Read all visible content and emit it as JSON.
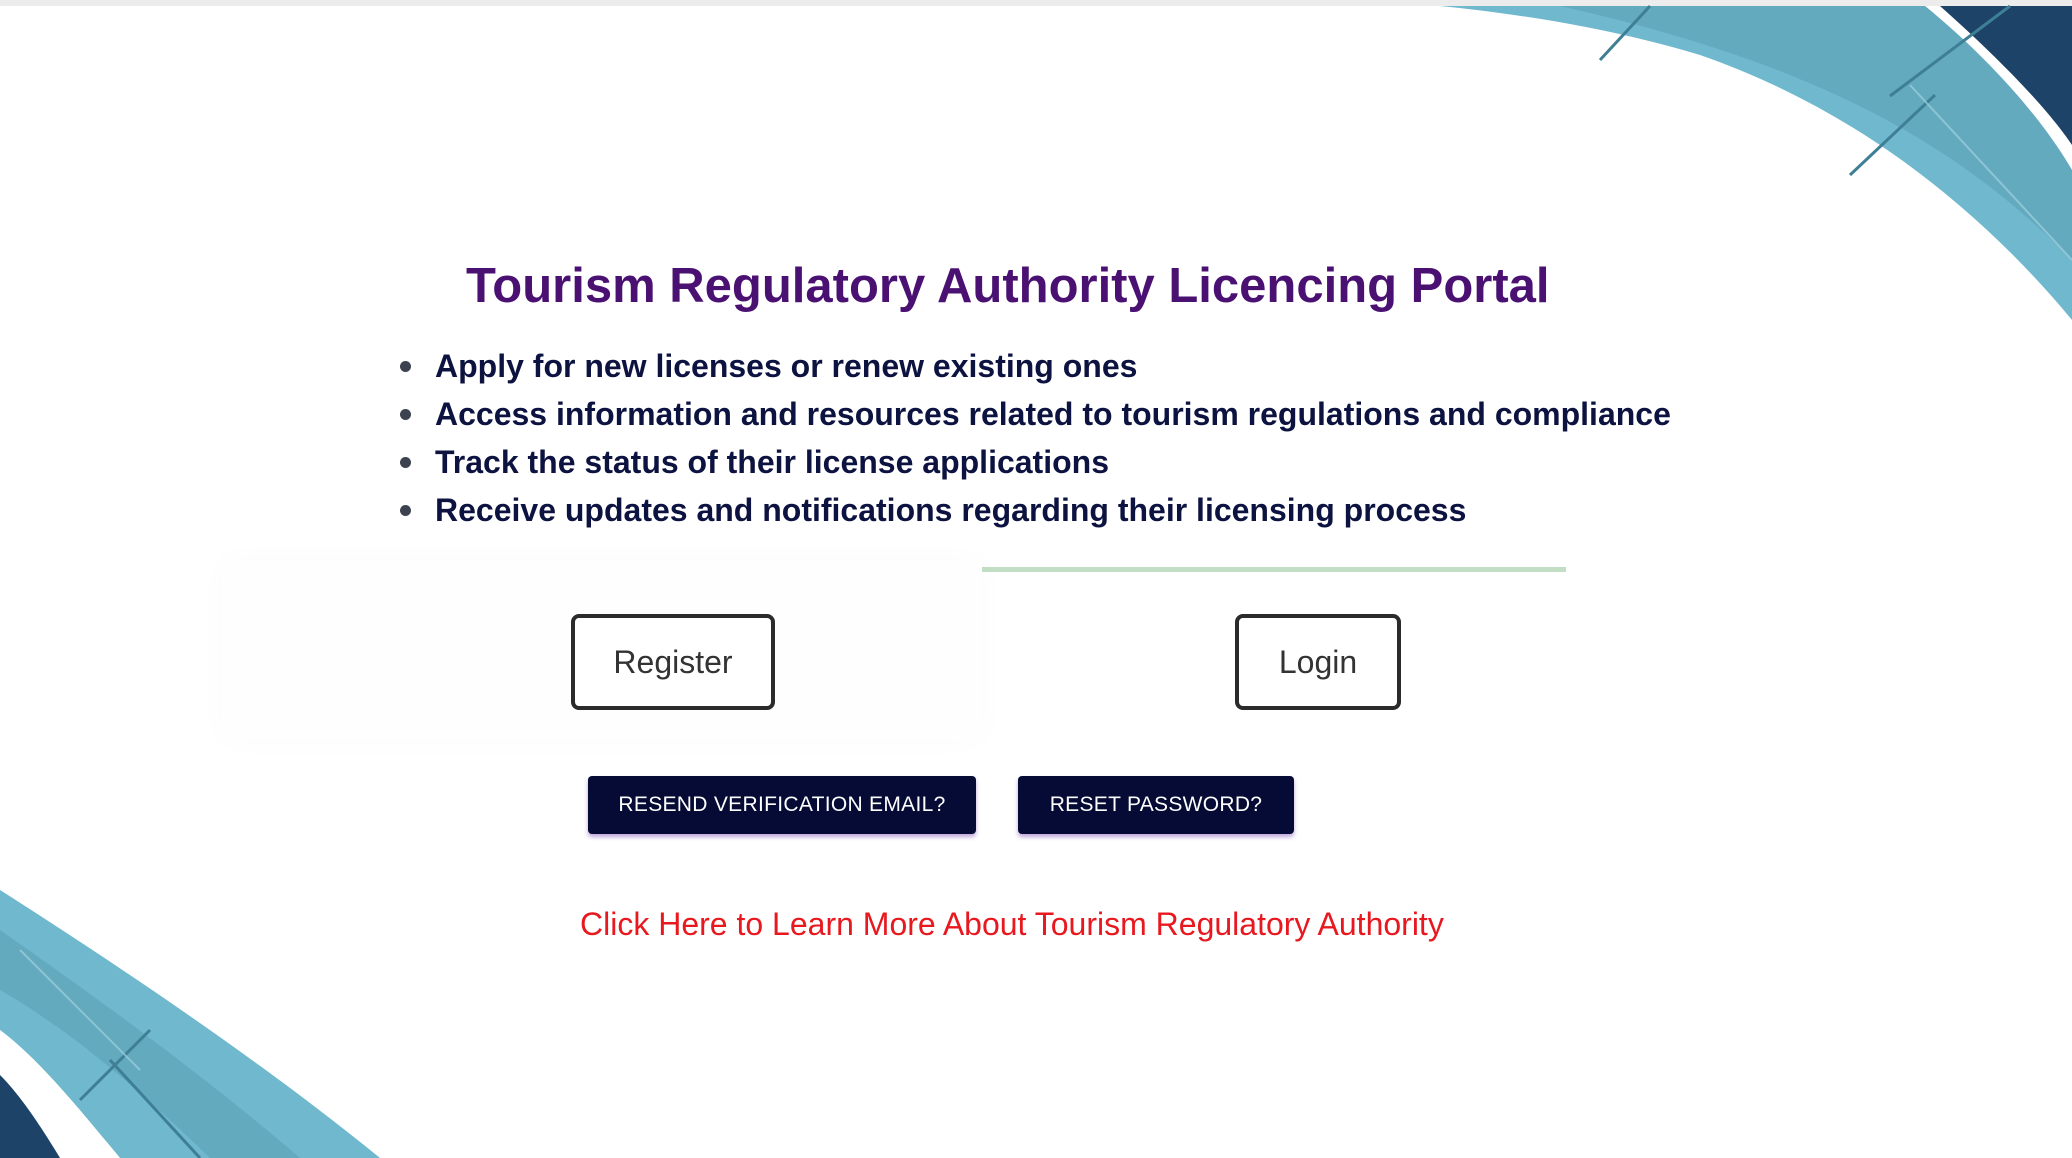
{
  "page": {
    "title": "Tourism Regulatory Authority Licencing Portal"
  },
  "features": [
    {
      "text": "Apply for new licenses or renew existing ones"
    },
    {
      "text": "Access information and resources related to tourism regulations and compliance"
    },
    {
      "text": "Track the status of their license applications"
    },
    {
      "text": "Receive updates and notifications regarding their licensing process"
    }
  ],
  "actions": {
    "register_label": "Register",
    "login_label": "Login",
    "resend_label": "RESEND VERIFICATION EMAIL?",
    "reset_label": "RESET PASSWORD?"
  },
  "links": {
    "learn_more": "Click Here to Learn More About Tourism Regulatory Authority"
  },
  "colors": {
    "title": "#4a1172",
    "feature_text": "#0d1340",
    "dark_button": "#050b35",
    "link": "#e8181f",
    "divider": "#c2dfc6",
    "swoosh_light": "#6fb8cd",
    "swoosh_dark": "#1d4468"
  }
}
